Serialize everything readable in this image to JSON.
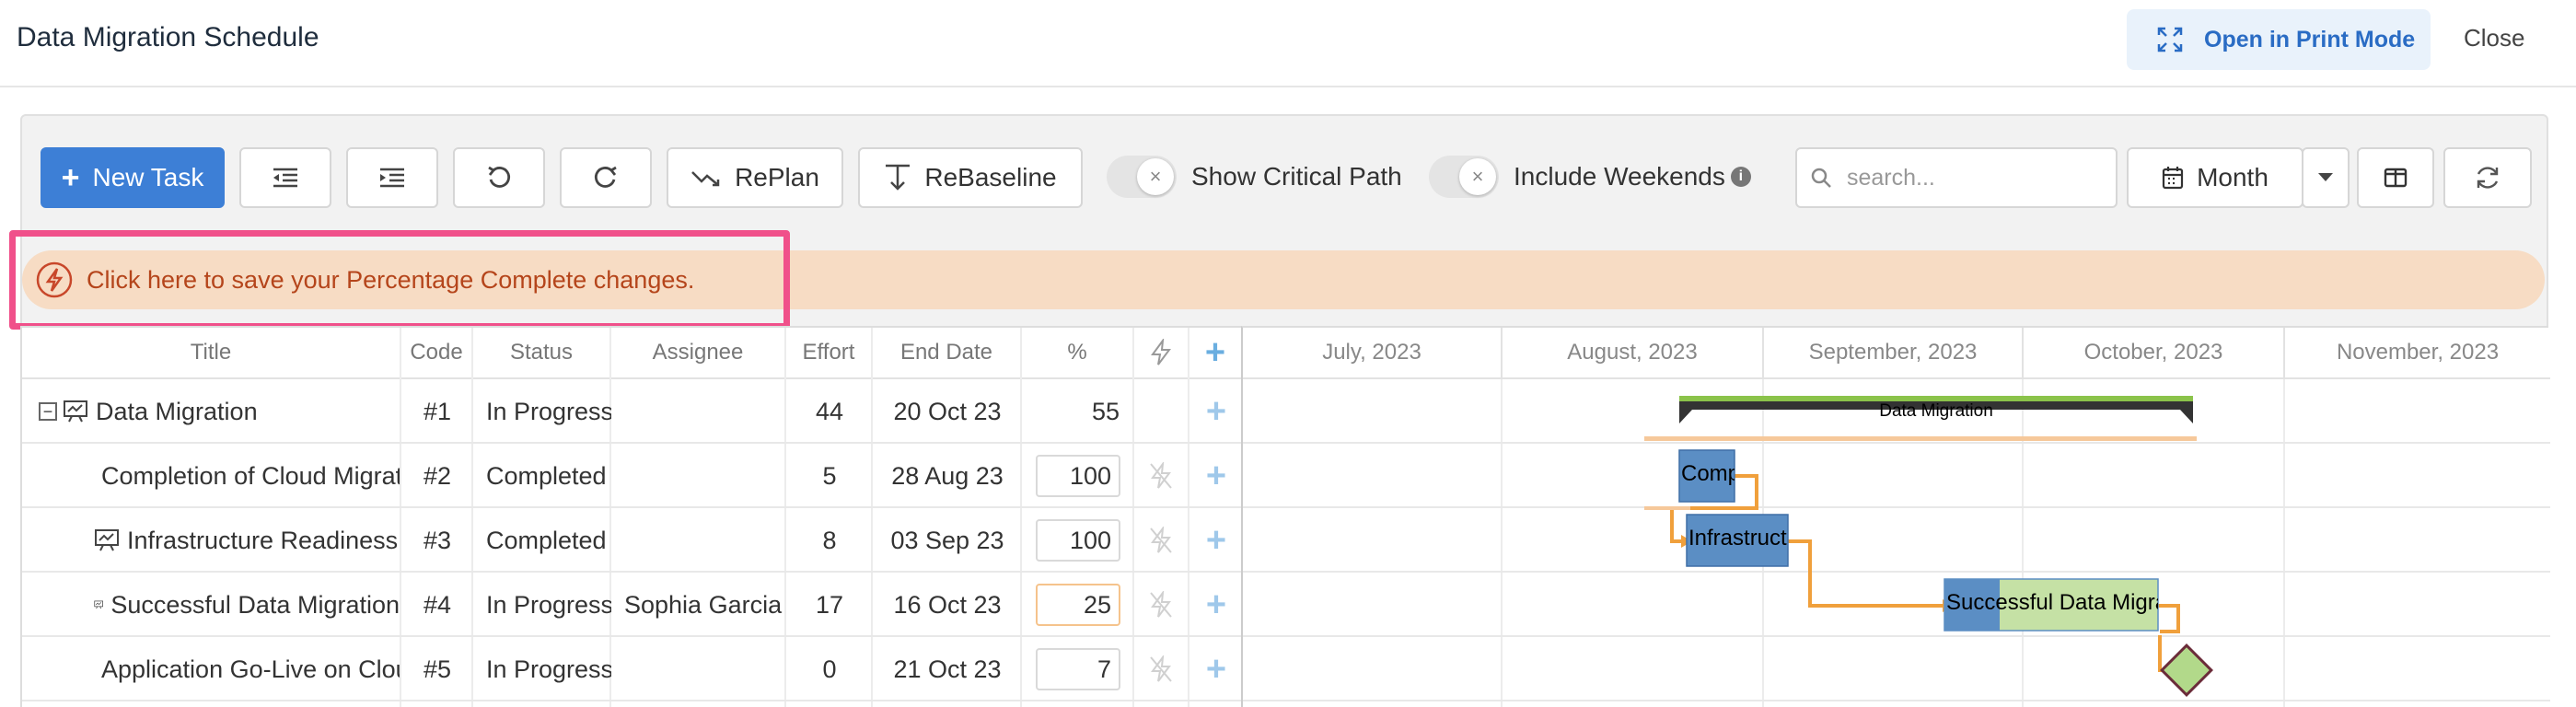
{
  "header": {
    "title": "Data Migration Schedule",
    "print_mode_label": "Open in Print Mode",
    "close_label": "Close"
  },
  "toolbar": {
    "new_task_label": "New Task",
    "replan_label": "RePlan",
    "rebaseline_label": "ReBaseline",
    "show_critical_path_label": "Show Critical Path",
    "include_weekends_label": "Include Weekends",
    "search_placeholder": "search...",
    "view_label": "Month"
  },
  "banner": {
    "message": "Click here to save your Percentage Complete changes."
  },
  "grid": {
    "columns": [
      "Title",
      "Code",
      "Status",
      "Assignee",
      "Effort",
      "End Date",
      "%"
    ],
    "rows": [
      {
        "title": "Data Migration",
        "code": "#1",
        "status": "In Progress",
        "assignee": "",
        "effort": "44",
        "end_date": "20 Oct 23",
        "percent": "55"
      },
      {
        "title": "Completion of Cloud Migration",
        "code": "#2",
        "status": "Completed",
        "assignee": "",
        "effort": "5",
        "end_date": "28 Aug 23",
        "percent": "100"
      },
      {
        "title": "Infrastructure Readiness",
        "code": "#3",
        "status": "Completed",
        "assignee": "",
        "effort": "8",
        "end_date": "03 Sep 23",
        "percent": "100"
      },
      {
        "title": "Successful Data Migration",
        "code": "#4",
        "status": "In Progress",
        "assignee": "Sophia Garcia",
        "effort": "17",
        "end_date": "16 Oct 23",
        "percent": "25"
      },
      {
        "title": "Application Go-Live on Cloud",
        "code": "#5",
        "status": "In Progress",
        "assignee": "",
        "effort": "0",
        "end_date": "21 Oct 23",
        "percent": "7"
      }
    ]
  },
  "gantt": {
    "months": [
      "July, 2023",
      "August, 2023",
      "September, 2023",
      "October, 2023",
      "November, 2023"
    ],
    "summary_label": "Data Migration",
    "bar_labels": [
      "Completion of Cloud Migration",
      "Infrastructure Readiness",
      "Successful Data Migration"
    ],
    "colors": {
      "bar_blue": "#5b8ec4",
      "bar_green": "#c5e1a5",
      "summary_dark": "#333333",
      "summary_green": "#8bc34a",
      "baseline": "#f6c89a",
      "dependency": "#f0a03c",
      "milestone": "#b2d98a"
    }
  }
}
